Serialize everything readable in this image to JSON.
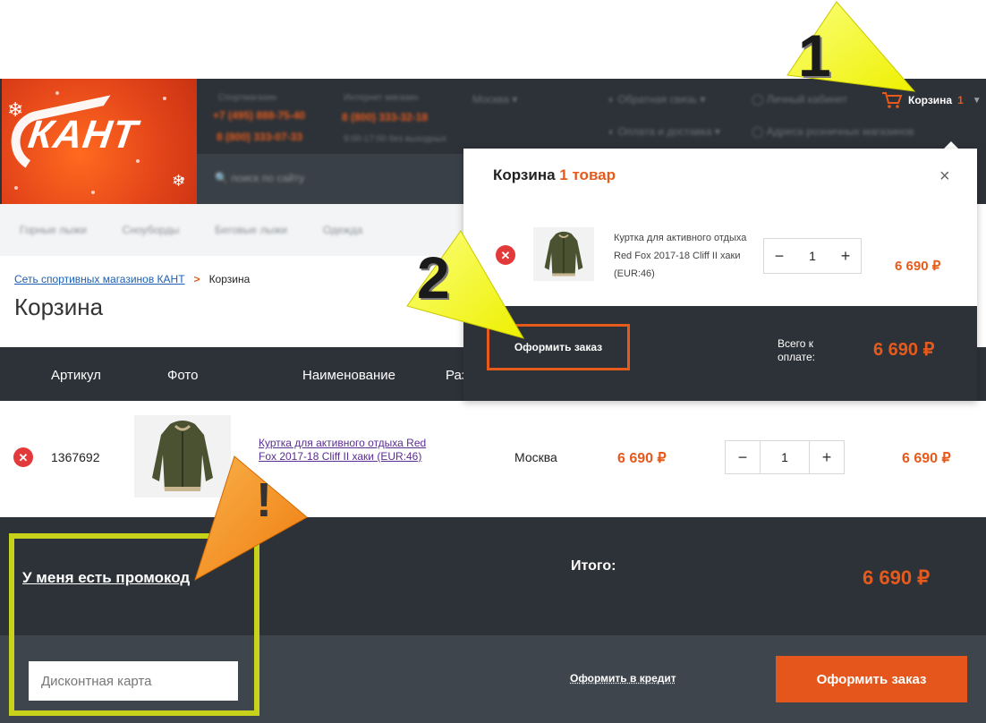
{
  "header": {
    "logo_text": "КАНТ",
    "cart_label": "Корзина",
    "cart_count": "1"
  },
  "breadcrumb": {
    "home": "Сеть спортивных магазинов КАНТ",
    "separator": ">",
    "current": "Корзина"
  },
  "page_title": "Корзина",
  "table": {
    "headers": [
      "Артикул",
      "Фото",
      "Наименование",
      "Раз"
    ]
  },
  "cart_row": {
    "sku": "1367692",
    "name": "Куртка для активного отдыха Red Fox 2017-18 Cliff II хаки (EUR:46)",
    "city": "Москва",
    "price": "6 690 ₽",
    "quantity": "1",
    "total": "6 690 ₽"
  },
  "summary": {
    "promo_link": "У меня есть промокод",
    "total_label": "Итого:",
    "total_value": "6 690 ₽",
    "discount_placeholder": "Дисконтная карта",
    "credit_link": "Оформить в кредит",
    "order_button": "Оформить заказ"
  },
  "dropdown": {
    "title": "Корзина",
    "count_text": "1 товар",
    "close": "×",
    "item_name": "Куртка для активного отдыха Red Fox 2017-18 Cliff II хаки (EUR:46)",
    "quantity": "1",
    "price": "6 690 ₽",
    "order_button": "Оформить заказ",
    "total_label": "Всего к оплате:",
    "total_value": "6 690 ₽"
  },
  "stepper": {
    "minus": "−",
    "plus": "+"
  },
  "annotations": {
    "one": "1",
    "two": "2",
    "exclaim": "!"
  },
  "colors": {
    "accent": "#e65a1c",
    "dark": "#2d3238",
    "highlight_yellow": "#f3f62a",
    "highlight_orange": "#f08a1c"
  }
}
